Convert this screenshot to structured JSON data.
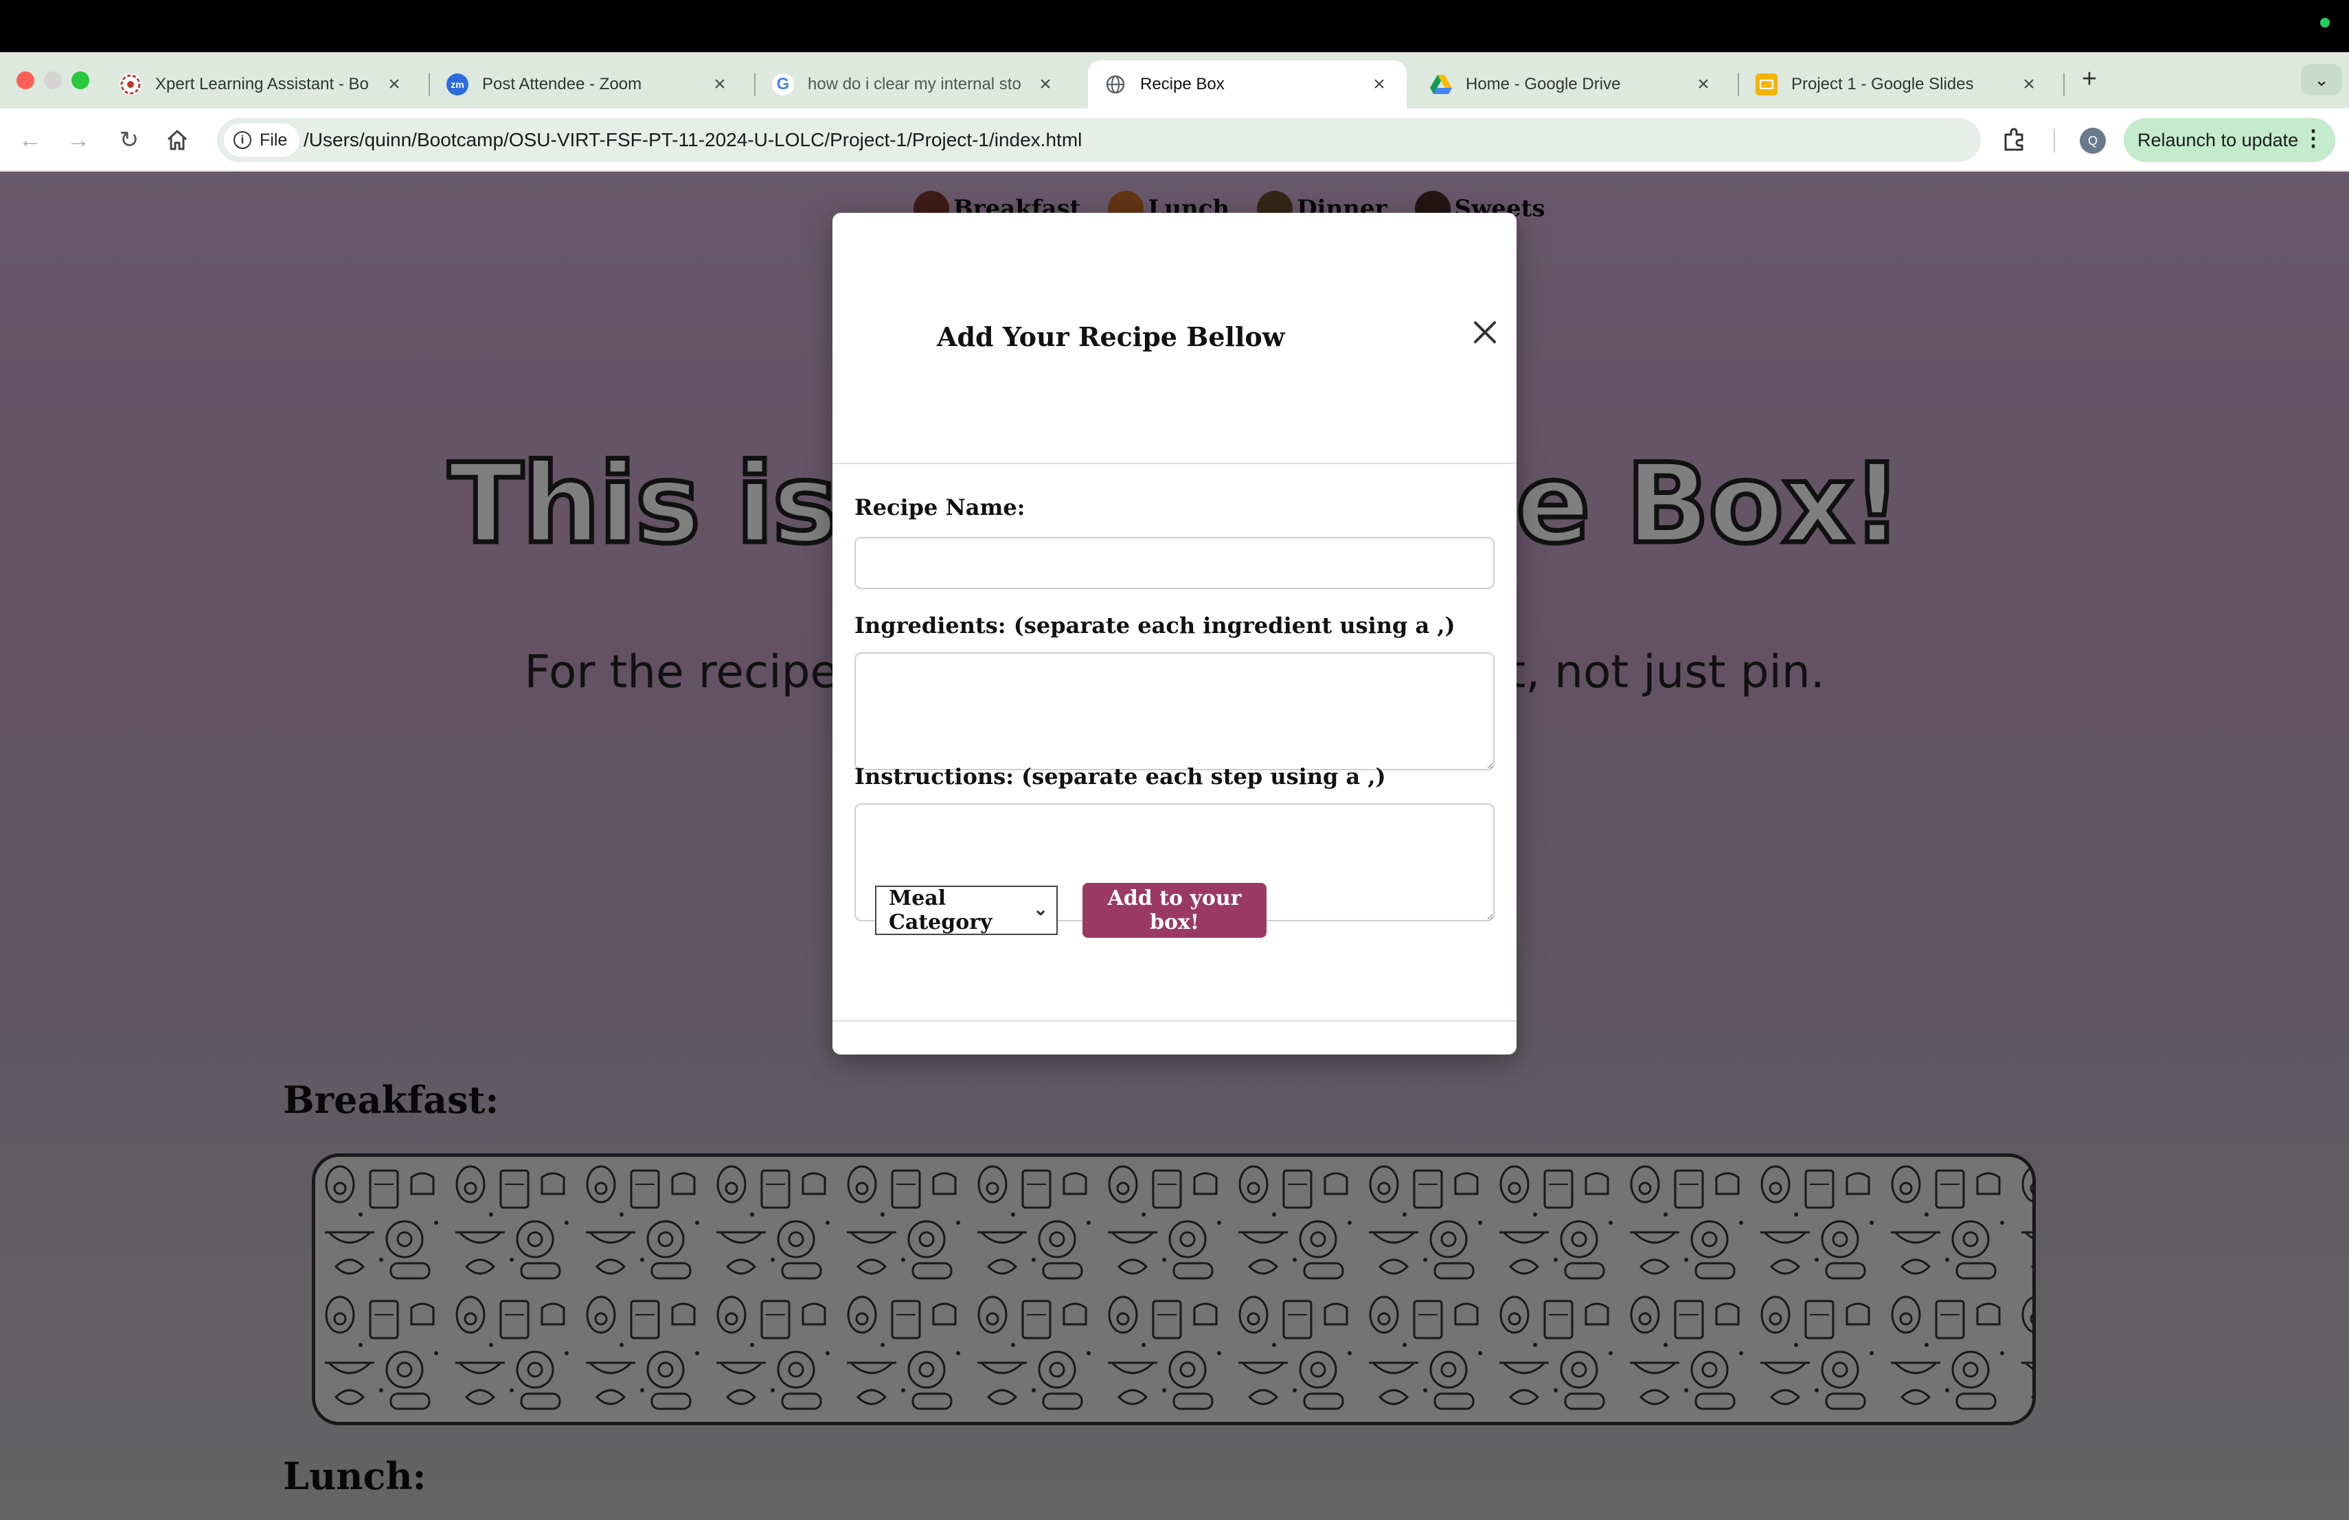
{
  "browser": {
    "tabs": [
      {
        "title": "Xpert Learning Assistant - Bo",
        "favicon_color": "#c0392b",
        "active": false
      },
      {
        "title": "Post Attendee - Zoom",
        "favicon_color": "#2d6cdf",
        "favicon_text": "zm",
        "active": false
      },
      {
        "title": "how do i clear my internal sto",
        "favicon_color": "#ffffff",
        "favicon_text": "G",
        "active": false
      },
      {
        "title": "Recipe Box",
        "favicon_color": "#5f6368",
        "active": true
      },
      {
        "title": "Home - Google Drive",
        "favicon_color": "#1fa463",
        "active": false
      },
      {
        "title": "Project 1 - Google Slides",
        "favicon_color": "#f4b400",
        "active": false
      }
    ],
    "new_tab_label": "+",
    "site_info_label": "File",
    "url": "/Users/quinn/Bootcamp/OSU-VIRT-FSF-PT-11-2024-U-LOLC/Project-1/Project-1/index.html",
    "avatar_initial": "Q",
    "relaunch_label": "Relaunch to update"
  },
  "page": {
    "nav": [
      {
        "label": "Breakfast",
        "dot_color": "#7a3a2a"
      },
      {
        "label": "Lunch",
        "dot_color": "#c96a2a"
      },
      {
        "label": "Dinner",
        "dot_color": "#6b4a2a"
      },
      {
        "label": "Sweets",
        "dot_color": "#4a2a2a"
      }
    ],
    "hero_title": "This is Your Recipe Box!",
    "hero_subtitle": "For the recipes you keep close to your heart, not just pin.",
    "sections": [
      {
        "heading": "Breakfast:"
      },
      {
        "heading": "Lunch:"
      }
    ]
  },
  "modal": {
    "title": "Add Your Recipe Bellow",
    "recipe_name_label": "Recipe Name:",
    "recipe_name_value": "",
    "ingredients_label": "Ingredients: (separate each ingredient using a ,)",
    "ingredients_value": "",
    "instructions_label": "Instructions: (separate each step using a ,)",
    "instructions_value": "",
    "category_selected": "Meal Category",
    "submit_label": "Add to your box!",
    "accent_color": "#9a3a63"
  }
}
